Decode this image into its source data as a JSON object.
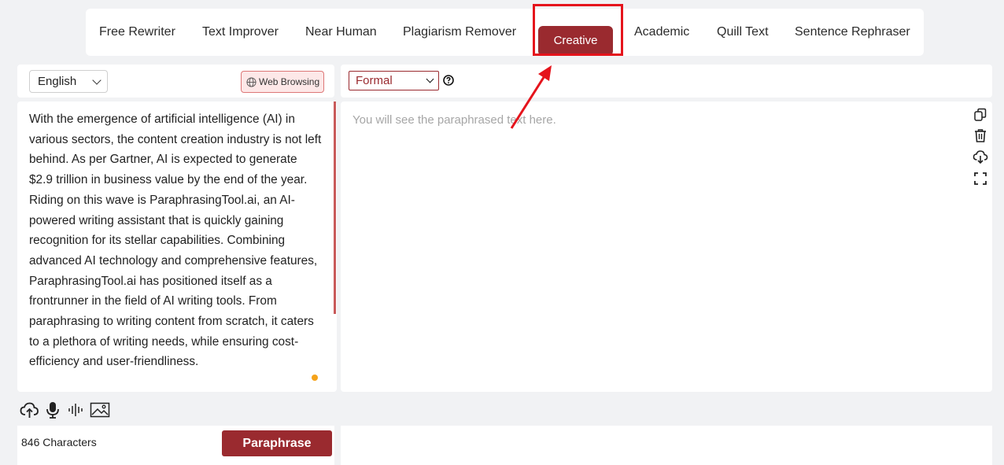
{
  "modes": [
    {
      "label": "Free Rewriter",
      "active": false
    },
    {
      "label": "Text Improver",
      "active": false
    },
    {
      "label": "Near Human",
      "active": false
    },
    {
      "label": "Plagiarism Remover",
      "active": false
    },
    {
      "label": "Creative",
      "active": true
    },
    {
      "label": "Academic",
      "active": false
    },
    {
      "label": "Quill Text",
      "active": false
    },
    {
      "label": "Sentence Rephraser",
      "active": false
    }
  ],
  "input_panel": {
    "language": "English",
    "web_browsing_label": "Web Browsing",
    "text": "With the emergence of artificial intelligence (AI) in various sectors, the content creation industry is not left behind. As per Gartner, AI is expected to generate $2.9 trillion in business value by the end of the year. Riding on this wave is ParaphrasingTool.ai, an AI-powered writing assistant that is quickly gaining recognition for its stellar capabilities. Combining advanced AI technology and comprehensive features, ParaphrasingTool.ai has positioned itself as a frontrunner in the field of AI writing tools. From paraphrasing to writing content from scratch, it caters to a plethora of writing needs, while ensuring cost-efficiency and user-friendliness.",
    "char_count": "846 Characters",
    "paraphrase_label": "Paraphrase"
  },
  "output_panel": {
    "tone": "Formal",
    "placeholder": "You will see the paraphrased text here."
  },
  "icons": {
    "side": [
      "copy-icon",
      "trash-icon",
      "download-icon",
      "fullscreen-icon"
    ],
    "tools": [
      "upload-cloud-icon",
      "microphone-icon",
      "audio-wave-icon",
      "image-icon"
    ]
  },
  "colors": {
    "brand": "#9a2a2f",
    "annotation": "#e5141c",
    "accent_dot": "#f5a31a"
  }
}
